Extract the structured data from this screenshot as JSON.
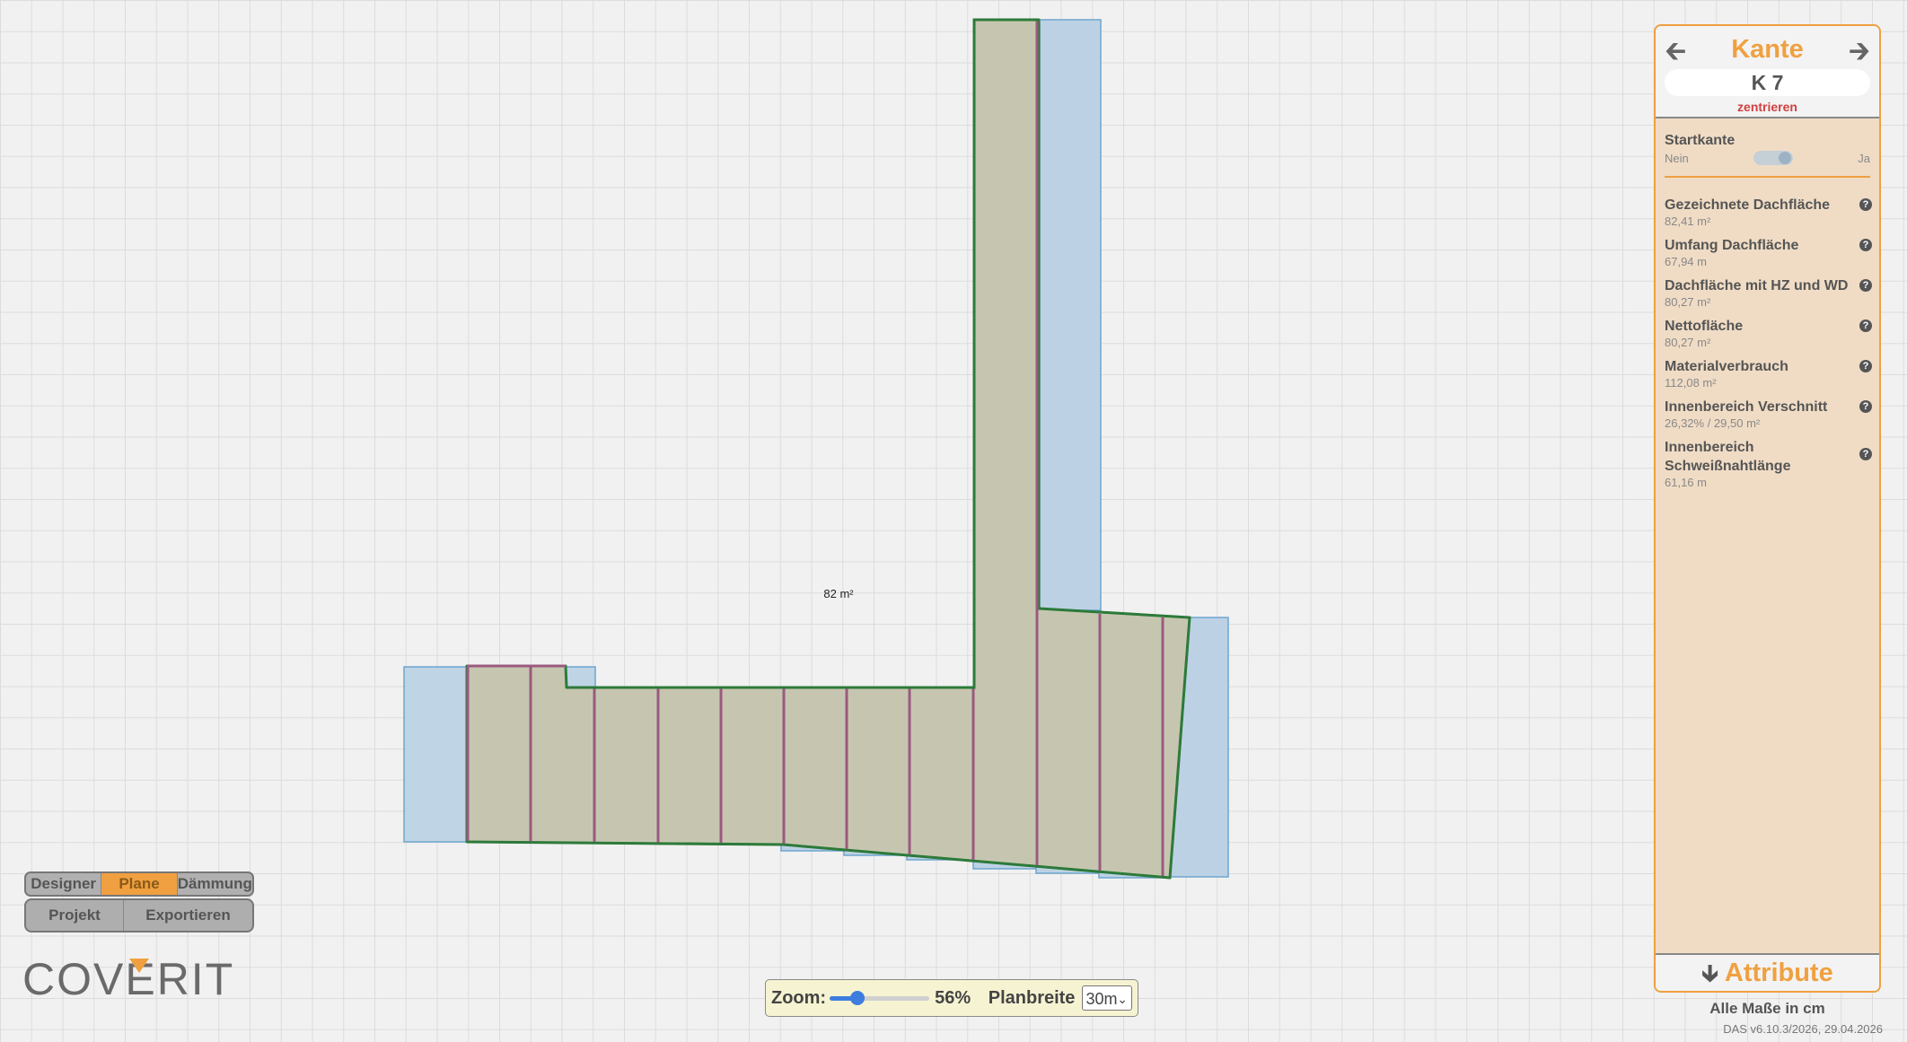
{
  "canvas": {
    "area_label": "82 m²",
    "colors": {
      "roof_fill": "#c6c6b0",
      "roof_outline": "#2d7a3a",
      "sheet_fill": "#bcd2e4",
      "sheet_outline": "#6ea6cf",
      "seam_line": "#9a5a80"
    }
  },
  "modes": [
    {
      "label": "Designer",
      "active": false
    },
    {
      "label": "Plane",
      "active": true
    },
    {
      "label": "Dämmung",
      "active": false
    }
  ],
  "actions": {
    "projekt": "Projekt",
    "exportieren": "Exportieren"
  },
  "logo": {
    "text": "COVERIT",
    "icon": "coverit-logo",
    "accent": "#f0a040"
  },
  "zoom": {
    "label": "Zoom:",
    "value_pct": 56,
    "value_text": "56%",
    "planbreite_label": "Planbreite",
    "planbreite_value": "30m"
  },
  "panel": {
    "title": "Kante",
    "prev_icon": "arrow-left-icon",
    "next_icon": "arrow-right-icon",
    "edge_id": "K 7",
    "center_link": "zentrieren",
    "startkante": {
      "label": "Startkante",
      "off": "Nein",
      "on": "Ja",
      "value": true
    },
    "stats": [
      {
        "name": "Gezeichnete Dachfläche",
        "value": "82,41 m²"
      },
      {
        "name": "Umfang Dachfläche",
        "value": "67,94 m"
      },
      {
        "name": "Dachfläche mit HZ und WD",
        "value": "80,27 m²"
      },
      {
        "name": "Nettofläche",
        "value": "80,27 m²"
      },
      {
        "name": "Materialverbrauch",
        "value": "112,08 m²"
      },
      {
        "name": "Innenbereich Verschnitt",
        "value": "26,32% / 29,50 m²"
      },
      {
        "name": "Innenbereich Schweißnahtlänge",
        "value": "61,16 m"
      }
    ],
    "footer_icon": "arrow-down-icon",
    "footer_label": "Attribute"
  },
  "units_note": "Alle Maße in cm",
  "version": "DAS v6.10.3/2026, 29.04.2026"
}
